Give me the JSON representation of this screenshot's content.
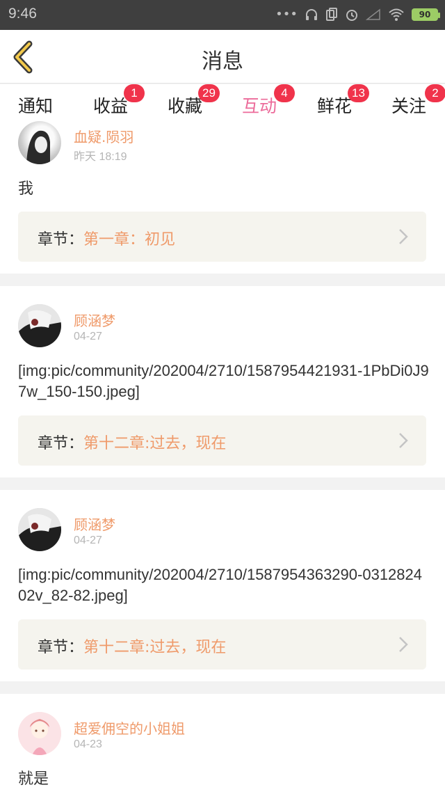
{
  "status_bar": {
    "time": "9:46",
    "battery": "90",
    "icons": [
      "more-dots-icon",
      "headset-icon",
      "sim-icon",
      "alarm-icon",
      "signal-icon",
      "wifi-icon"
    ]
  },
  "header": {
    "title": "消息",
    "back_icon": "chevron-left-icon"
  },
  "tabs": [
    {
      "label": "通知",
      "badge": ""
    },
    {
      "label": "收益",
      "badge": "1"
    },
    {
      "label": "收藏",
      "badge": "29"
    },
    {
      "label": "互动",
      "badge": "4",
      "active": true
    },
    {
      "label": "鲜花",
      "badge": "13"
    },
    {
      "label": "关注",
      "badge": "2"
    }
  ],
  "messages": [
    {
      "name": "血疑.陨羽",
      "date": "昨天 18:19",
      "content": "我",
      "chapter_label": "章节：",
      "chapter_title": "第一章：初见"
    },
    {
      "name": "顾涵梦",
      "date": "04-27",
      "content": "[img:pic/community/202004/2710/1587954421931-1PbDi0J97w_150-150.jpeg]",
      "chapter_label": "章节：",
      "chapter_title": "第十二章:过去，现在"
    },
    {
      "name": "顾涵梦",
      "date": "04-27",
      "content": "[img:pic/community/202004/2710/1587954363290-031282402v_82-82.jpeg]",
      "chapter_label": "章节：",
      "chapter_title": "第十二章:过去，现在"
    },
    {
      "name": "超爱佣空的小姐姐",
      "date": "04-23",
      "content": "就是"
    }
  ],
  "colors": {
    "accent_pink": "#ec6b9a",
    "name_orange": "#ef9a6a",
    "badge_red": "#f0334b",
    "back_yellow": "#f2c94c"
  }
}
